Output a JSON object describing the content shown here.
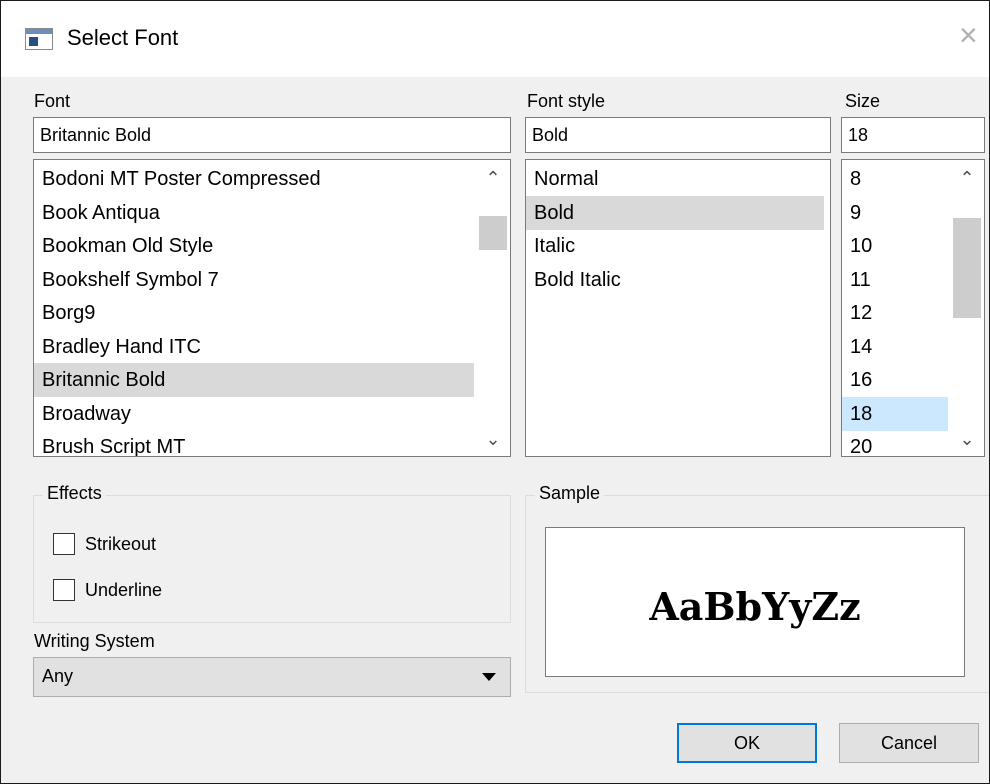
{
  "window": {
    "title": "Select Font",
    "icon": "app-window-icon",
    "close_icon": "close-icon"
  },
  "font": {
    "label": "Font",
    "value": "Britannic Bold",
    "items": [
      "Bodoni MT Poster Compressed",
      "Book Antiqua",
      "Bookman Old Style",
      "Bookshelf Symbol 7",
      "Borg9",
      "Bradley Hand ITC",
      "Britannic Bold",
      "Broadway",
      "Brush Script MT"
    ],
    "selected": "Britannic Bold"
  },
  "font_style": {
    "label": "Font style",
    "value": "Bold",
    "items": [
      "Normal",
      "Bold",
      "Italic",
      "Bold Italic"
    ],
    "selected": "Bold"
  },
  "size": {
    "label": "Size",
    "value": "18",
    "items": [
      "8",
      "9",
      "10",
      "11",
      "12",
      "14",
      "16",
      "18",
      "20"
    ],
    "selected": "18"
  },
  "effects": {
    "title": "Effects",
    "strikeout_label": "Strikeout",
    "strikeout_checked": false,
    "underline_label": "Underline",
    "underline_checked": false
  },
  "writing_system": {
    "label": "Writing System",
    "value": "Any"
  },
  "sample": {
    "title": "Sample",
    "text": "AaBbYyZz"
  },
  "buttons": {
    "ok": "OK",
    "cancel": "Cancel"
  },
  "colors": {
    "selection_gray": "#d9d9d9",
    "selection_blue": "#cce8ff",
    "default_button_border": "#0078d7"
  }
}
